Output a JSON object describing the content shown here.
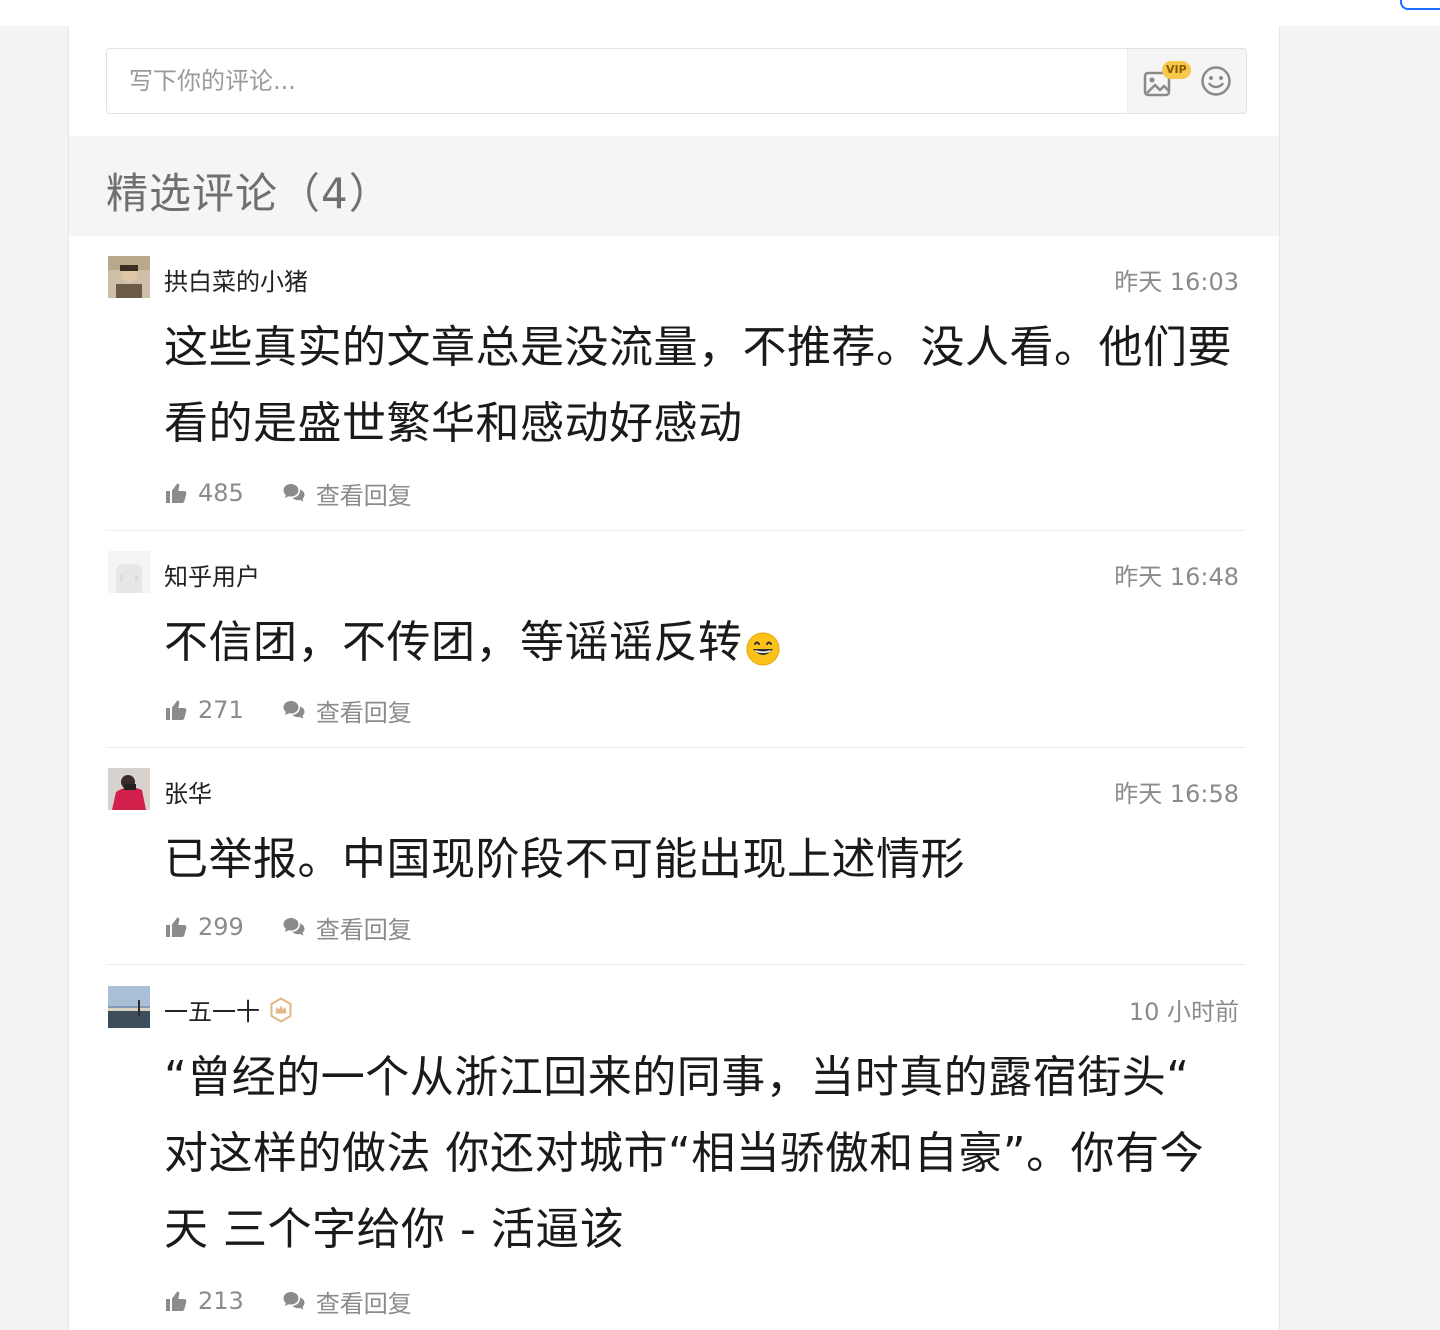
{
  "composer": {
    "placeholder": "写下你的评论...",
    "vip_badge": "VIP"
  },
  "section": {
    "title": "精选评论（4）"
  },
  "comments": [
    {
      "author": "拱白菜的小猪",
      "time": "昨天 16:03",
      "body": "这些真实的文章总是没流量，不推荐。没人看。他们要看的是盛世繁华和感动好感动",
      "likes": "485",
      "reply_label": "查看回复"
    },
    {
      "author": "知乎用户",
      "time": "昨天 16:48",
      "body": "不信团，不传团，等谣谣反转",
      "inline_emoji": "grinning-face-emoji",
      "likes": "271",
      "reply_label": "查看回复"
    },
    {
      "author": "张华",
      "time": "昨天 16:58",
      "body": "已举报。中国现阶段不可能出现上述情形",
      "likes": "299",
      "reply_label": "查看回复"
    },
    {
      "author": "一五一十",
      "author_badge": "crown-badge-icon",
      "time": "10 小时前",
      "body": "“曾经的一个从浙江回来的同事，当时真的露宿街头“ 对这样的做法 你还对城市“相当骄傲和自豪”。你有今天 三个字给你 - 活逼该",
      "likes": "213",
      "reply_label": "查看回复"
    }
  ],
  "colors": {
    "accent_blue": "#1e6fff",
    "vip_gold": "#f6c84b",
    "muted_text": "#8b8b8b",
    "section_bg": "#f5f5f5"
  }
}
